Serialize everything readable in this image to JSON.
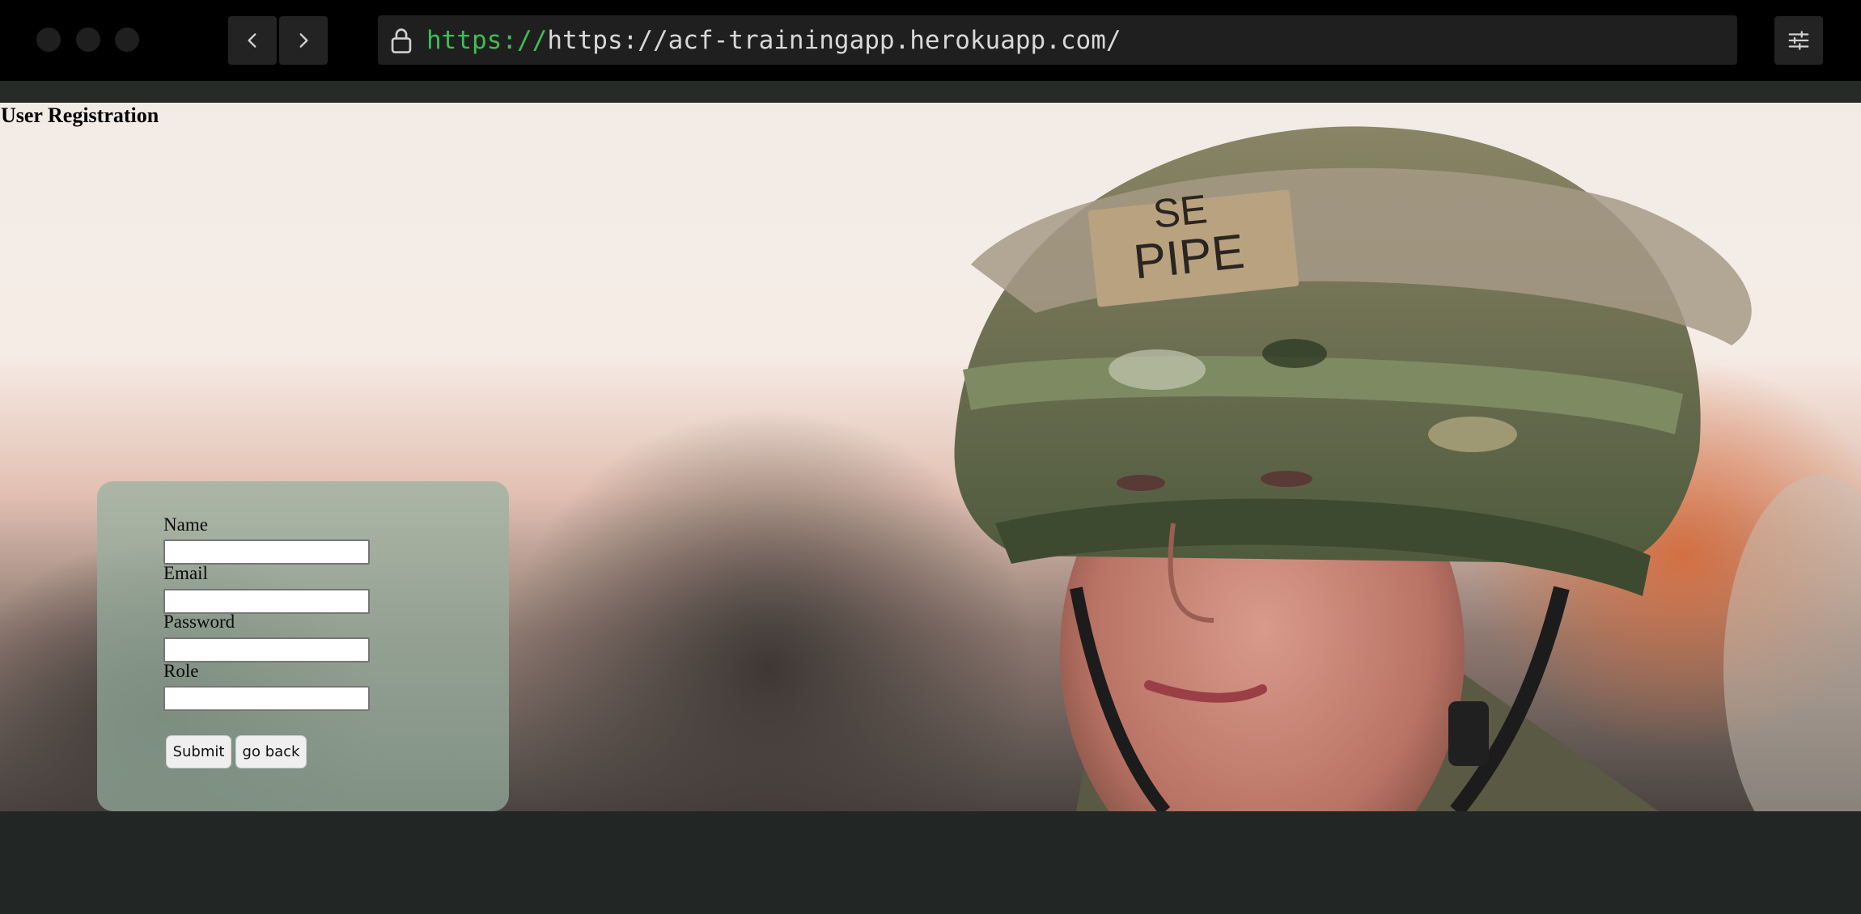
{
  "browser": {
    "url_scheme": "https://",
    "url_rest": "https://acf-trainingapp.herokuapp.com/",
    "icons": {
      "back": "chevron-left-icon",
      "forward": "chevron-right-icon",
      "lock": "lock-icon",
      "settings": "sliders-icon"
    }
  },
  "page": {
    "title": "User Registration",
    "background_image": "soldier in camouflage helmet (photo)"
  },
  "form": {
    "fields": [
      {
        "label": "Name",
        "value": "",
        "placeholder": ""
      },
      {
        "label": "Email",
        "value": "",
        "placeholder": ""
      },
      {
        "label": "Password",
        "value": "",
        "placeholder": ""
      },
      {
        "label": "Role",
        "value": "",
        "placeholder": ""
      }
    ],
    "submit_label": "Submit",
    "back_label": "go back"
  },
  "colors": {
    "url_scheme": "#3fbf4f",
    "panel": "#96b0a0"
  }
}
